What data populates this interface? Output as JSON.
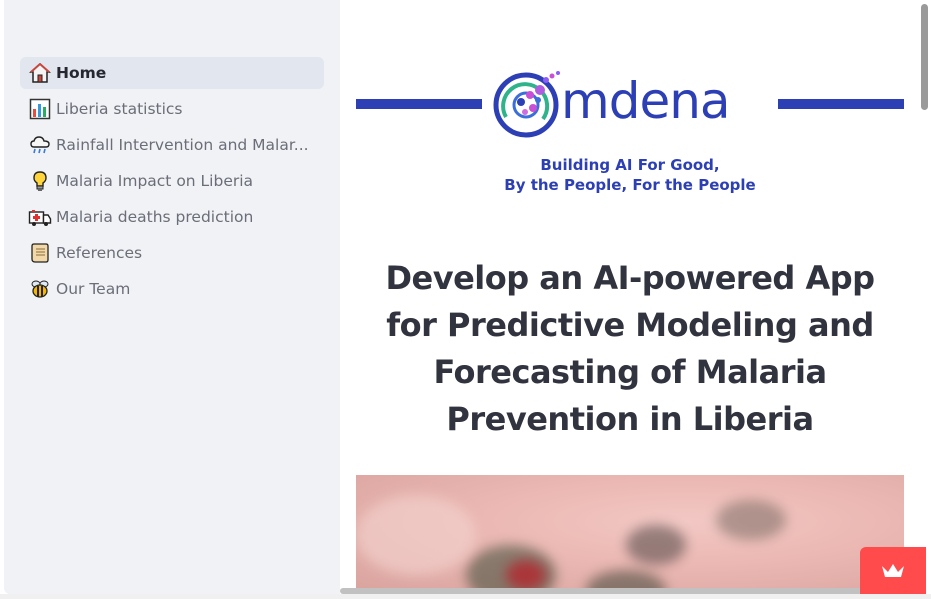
{
  "sidebar": {
    "items": [
      {
        "label": "Home",
        "icon": "house-icon",
        "active": true
      },
      {
        "label": "Liberia statistics",
        "icon": "bar-chart-icon",
        "active": false
      },
      {
        "label": "Rainfall Intervention and Malar...",
        "icon": "rain-cloud-icon",
        "active": false
      },
      {
        "label": "Malaria Impact on Liberia",
        "icon": "light-bulb-icon",
        "active": false
      },
      {
        "label": "Malaria deaths prediction",
        "icon": "ambulance-icon",
        "active": false
      },
      {
        "label": "References",
        "icon": "scroll-icon",
        "active": false
      },
      {
        "label": "Our Team",
        "icon": "bee-icon",
        "active": false
      }
    ]
  },
  "main": {
    "logo": {
      "word": "mdena",
      "brand_color": "#2c3fb5"
    },
    "tagline_line1": "Building AI For Good,",
    "tagline_line2": "By the People, For the People",
    "headline": "Develop an AI-powered App for Predictive Modeling and Forecasting of Malaria Prevention in Liberia"
  },
  "fab": {
    "icon": "crown-icon",
    "color": "#ff4b4b"
  }
}
